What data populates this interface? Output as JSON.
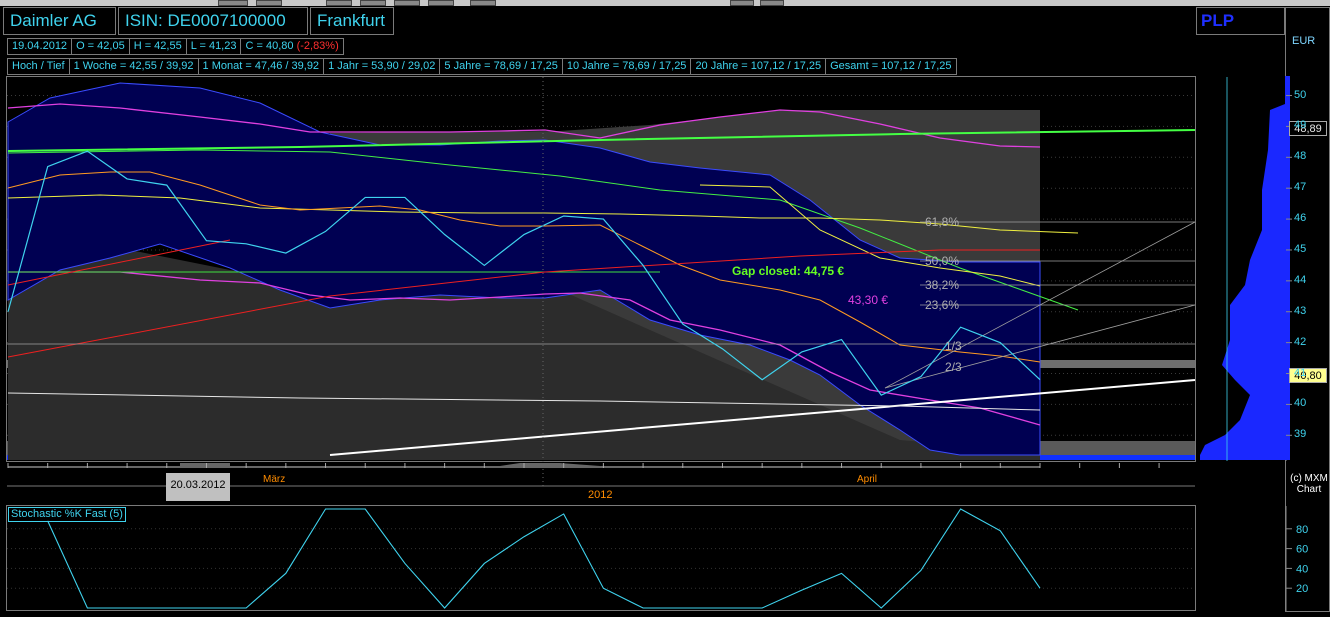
{
  "header": {
    "company": "Daimler AG",
    "isin": "ISIN: DE0007100000",
    "exchange": "Frankfurt",
    "provider": "PLP",
    "currency": "EUR"
  },
  "quote": {
    "date": "19.04.2012",
    "open": "O = 42,05",
    "high": "H = 42,55",
    "low": "L = 41,23",
    "close": "C = 40,80",
    "change": "(-2,83%)"
  },
  "ranges": [
    "Hoch / Tief",
    "1 Woche = 42,55 / 39,92",
    "1 Monat = 47,46 / 39,92",
    "1 Jahr = 53,90 / 29,02",
    "5 Jahre = 78,69 / 17,25",
    "10 Jahre = 78,69 / 17,25",
    "20 Jahre = 107,12 / 17,25",
    "Gesamt = 107,12 / 17,25"
  ],
  "price_tags": {
    "level_upper": "48,89",
    "level_last": "40,80"
  },
  "annotations": {
    "gap": "Gap closed:  44,75 €",
    "mark": "43,30 €",
    "fib_618": "61,8%",
    "fib_500": "50,0%",
    "fib_382": "38,2%",
    "fib_236": "23,6%",
    "third_1": "1/3",
    "third_2": "2/3"
  },
  "xaxis": {
    "selected_date": "20.03.2012",
    "month_1": "März",
    "month_2": "April",
    "year": "2012"
  },
  "footer": {
    "copyright": "(c) MXM",
    "chart": "Chart"
  },
  "colors": {
    "accent": "#3fd3ee",
    "background": "#000000",
    "band": "#000055",
    "negative": "#ff3030"
  },
  "chart_data": [
    {
      "type": "line",
      "title": "",
      "yaxis_ticks": [
        39,
        40,
        41,
        42,
        43,
        44,
        45,
        46,
        47,
        48,
        49,
        50
      ],
      "ylim": [
        38.2,
        50.6
      ],
      "series": [
        {
          "name": "",
          "color": "#3fd3ee",
          "values": [
            43.0,
            47.7,
            48.2,
            47.3,
            47.1,
            45.3,
            45.2,
            44.9,
            45.6,
            46.7,
            46.7,
            45.5,
            44.5,
            45.5,
            46.1,
            46.0,
            44.5,
            42.6,
            41.8,
            40.8,
            41.7,
            42.1,
            40.3,
            40.9,
            42.5,
            42.0,
            40.8
          ]
        }
      ],
      "closing_price": 40.8,
      "gap_closed": 44.75,
      "marked_level": 43.3,
      "fibonacci_levels": [
        "61,8%",
        "50,0%",
        "38,2%",
        "23,6%"
      ]
    },
    {
      "type": "line",
      "title": "Stochastic %K Fast (5)",
      "yaxis_ticks": [
        20,
        40,
        60,
        80
      ],
      "ylim": [
        0,
        100
      ],
      "series": [
        {
          "name": "",
          "color": "#3fd3ee",
          "values": [
            null,
            88,
            0,
            0,
            0,
            0,
            0,
            35,
            100,
            100,
            45,
            0,
            45,
            72,
            95,
            20,
            0,
            0,
            0,
            0,
            18,
            35,
            0,
            38,
            100,
            78,
            20
          ]
        }
      ]
    }
  ]
}
